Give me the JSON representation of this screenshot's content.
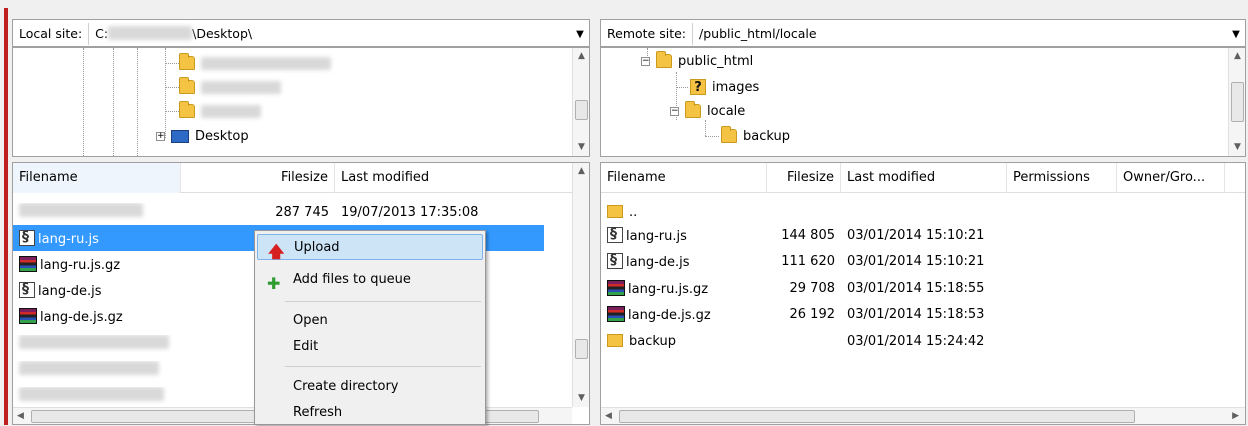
{
  "local": {
    "site_label": "Local site:",
    "path_prefix": "C:",
    "path_suffix": "\\Desktop\\",
    "tree_desktop": "Desktop",
    "columns": {
      "filename": "Filename",
      "filesize": "Filesize",
      "modified": "Last modified"
    },
    "rows": [
      {
        "name": "",
        "size": "287 745",
        "modified": "19/07/2013 17:35:08",
        "type": "blurred"
      },
      {
        "name": "lang-ru.js",
        "size": "",
        "modified": "",
        "type": "js",
        "selected": true
      },
      {
        "name": "lang-ru.js.gz",
        "size": "",
        "modified": "",
        "type": "gz"
      },
      {
        "name": "lang-de.js",
        "size": "",
        "modified": "",
        "type": "js"
      },
      {
        "name": "lang-de.js.gz",
        "size": "",
        "modified": "",
        "type": "gz"
      }
    ]
  },
  "remote": {
    "site_label": "Remote site:",
    "path": "/public_html/locale",
    "tree": {
      "root": "public_html",
      "images": "images",
      "locale": "locale",
      "backup": "backup"
    },
    "columns": {
      "filename": "Filename",
      "filesize": "Filesize",
      "modified": "Last modified",
      "permissions": "Permissions",
      "owner": "Owner/Gro..."
    },
    "rows": [
      {
        "name": "..",
        "size": "",
        "modified": "",
        "type": "folder"
      },
      {
        "name": "lang-ru.js",
        "size": "144 805",
        "modified": "03/01/2014 15:10:21",
        "type": "js"
      },
      {
        "name": "lang-de.js",
        "size": "111 620",
        "modified": "03/01/2014 15:10:21",
        "type": "js"
      },
      {
        "name": "lang-ru.js.gz",
        "size": "29 708",
        "modified": "03/01/2014 15:18:55",
        "type": "gz"
      },
      {
        "name": "lang-de.js.gz",
        "size": "26 192",
        "modified": "03/01/2014 15:18:53",
        "type": "gz"
      },
      {
        "name": "backup",
        "size": "",
        "modified": "03/01/2014 15:24:42",
        "type": "folder"
      }
    ]
  },
  "context_menu": {
    "upload": "Upload",
    "add_queue": "Add files to queue",
    "open": "Open",
    "edit": "Edit",
    "create_dir": "Create directory",
    "refresh": "Refresh"
  },
  "colors": {
    "selection": "#3399ff",
    "menu_highlight": "#cde4f7",
    "upload_arrow": "#d62020",
    "queue_arrow": "#2e9b2e"
  }
}
